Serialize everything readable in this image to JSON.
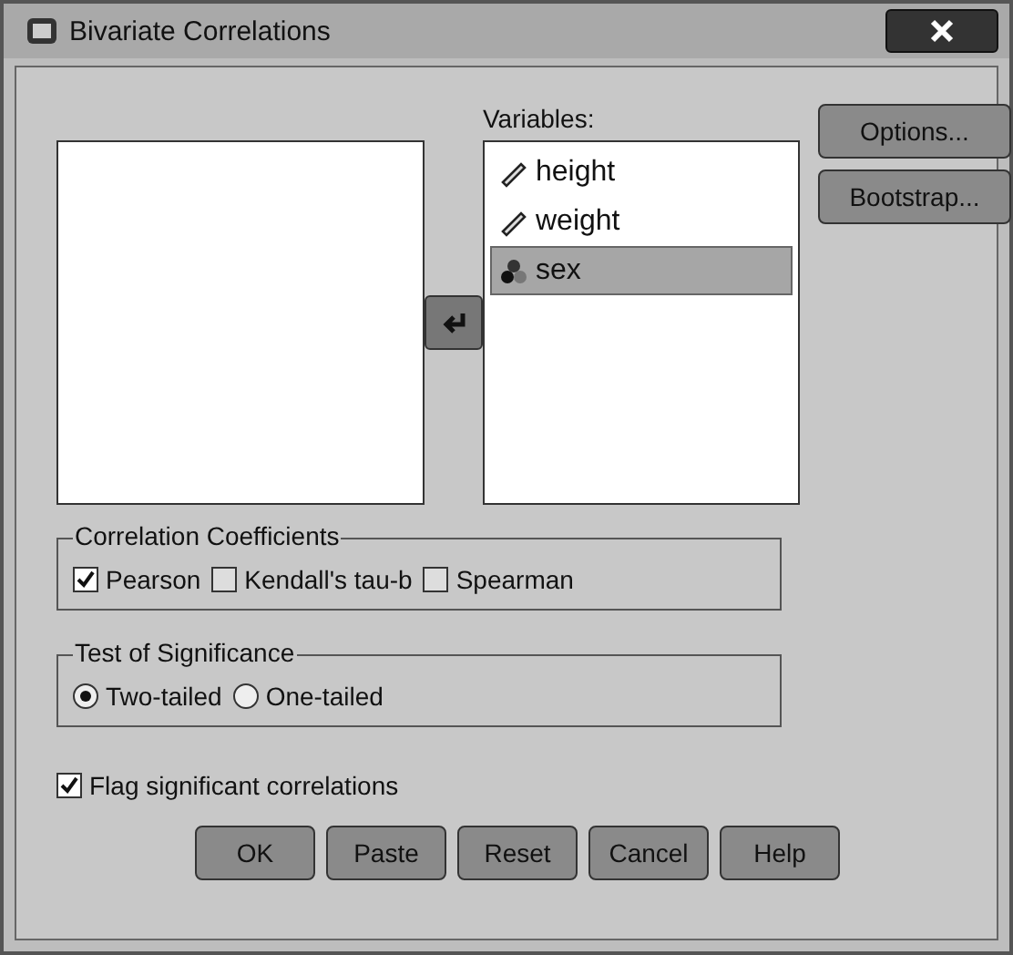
{
  "window": {
    "title": "Bivariate Correlations"
  },
  "variables_label": "Variables:",
  "variables": [
    {
      "name": "height",
      "kind": "scale",
      "selected": false
    },
    {
      "name": "weight",
      "kind": "scale",
      "selected": false
    },
    {
      "name": "sex",
      "kind": "nominal",
      "selected": true
    }
  ],
  "side_buttons": [
    "Options...",
    "Bootstrap..."
  ],
  "coefficients": {
    "title": "Correlation Coefficients",
    "options": [
      {
        "label": "Pearson",
        "checked": true
      },
      {
        "label": "Kendall's tau-b",
        "checked": false
      },
      {
        "label": "Spearman",
        "checked": false
      }
    ]
  },
  "significance": {
    "title": "Test of Significance",
    "options": [
      {
        "label": "Two-tailed",
        "selected": true
      },
      {
        "label": "One-tailed",
        "selected": false
      }
    ]
  },
  "flag": {
    "label": "Flag significant correlations",
    "checked": true
  },
  "buttons": [
    "OK",
    "Paste",
    "Reset",
    "Cancel",
    "Help"
  ]
}
